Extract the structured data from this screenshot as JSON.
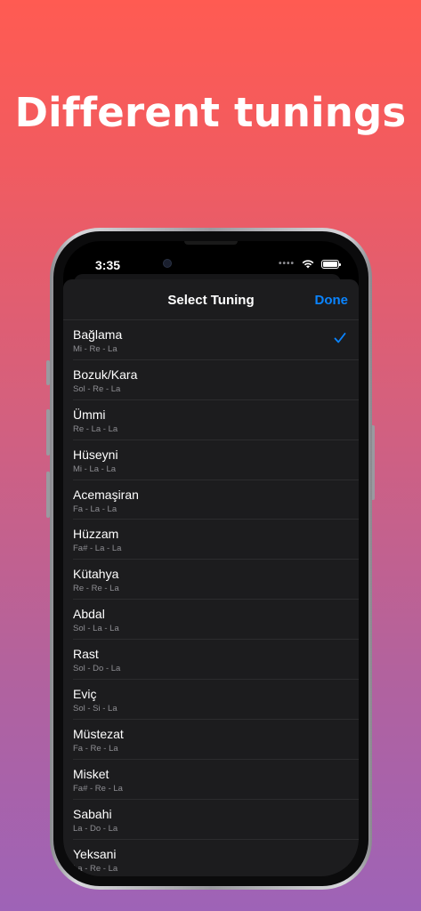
{
  "headline": "Different tunings",
  "status": {
    "time": "3:35"
  },
  "nav": {
    "title": "Select Tuning",
    "done_label": "Done"
  },
  "accent_color": "#0a84ff",
  "tunings": [
    {
      "name": "Bağlama",
      "notes": "Mi - Re - La",
      "selected": true
    },
    {
      "name": "Bozuk/Kara",
      "notes": "Sol - Re - La"
    },
    {
      "name": "Ümmi",
      "notes": "Re - La - La"
    },
    {
      "name": "Hüseyni",
      "notes": "Mi - La - La"
    },
    {
      "name": "Acemaşiran",
      "notes": "Fa - La - La"
    },
    {
      "name": "Hüzzam",
      "notes": "Fa# - La - La"
    },
    {
      "name": "Kütahya",
      "notes": "Re - Re - La"
    },
    {
      "name": "Abdal",
      "notes": "Sol - La - La"
    },
    {
      "name": "Rast",
      "notes": "Sol - Do - La"
    },
    {
      "name": "Eviç",
      "notes": "Sol - Si - La"
    },
    {
      "name": "Müstezat",
      "notes": "Fa - Re - La"
    },
    {
      "name": "Misket",
      "notes": "Fa# - Re - La"
    },
    {
      "name": "Sabahi",
      "notes": "La - Do - La"
    },
    {
      "name": "Yeksani",
      "notes": "La - Re - La"
    }
  ]
}
